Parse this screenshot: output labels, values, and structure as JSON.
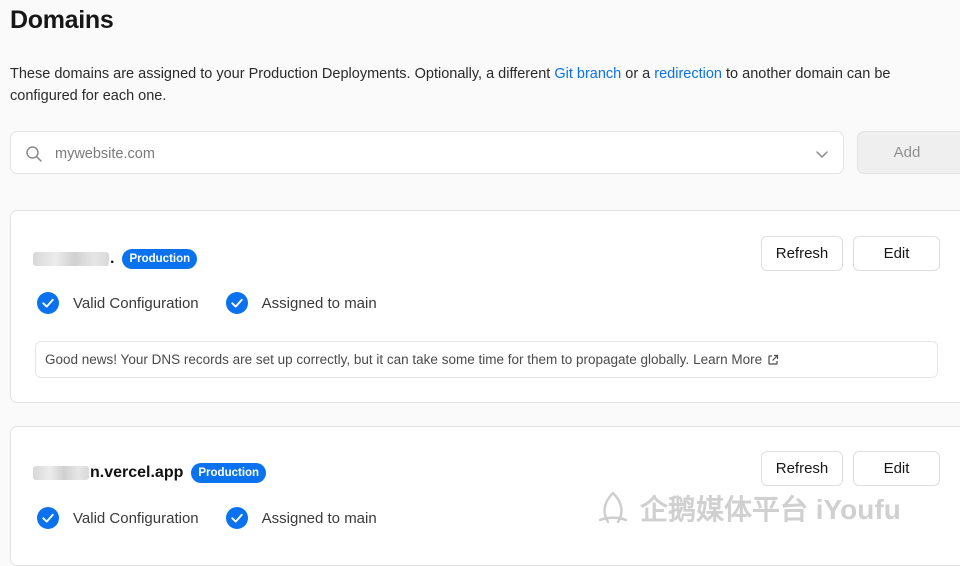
{
  "page": {
    "title": "Domains",
    "description": {
      "part1": "These domains are assigned to your Production Deployments. Optionally, a different ",
      "link1": "Git branch",
      "part2": " or a ",
      "link2": "redirection",
      "part3": " to another domain can be configured for each one."
    }
  },
  "search": {
    "placeholder": "mywebsite.com",
    "icon": "search-icon",
    "dropdown_icon": "chevron-down-icon",
    "add_label": "Add"
  },
  "domains": [
    {
      "suffix": ".",
      "badge": "Production",
      "refresh_label": "Refresh",
      "edit_label": "Edit",
      "status1": "Valid Configuration",
      "status2": "Assigned to main",
      "notice": "Good news! Your DNS records are set up correctly, but it can take some time for them to propagate globally.",
      "learn_more": "Learn More"
    },
    {
      "suffix": "n.vercel.app",
      "badge": "Production",
      "refresh_label": "Refresh",
      "edit_label": "Edit",
      "status1": "Valid Configuration",
      "status2": "Assigned to main"
    }
  ],
  "watermark": {
    "text": "企鹅媒体平台 iYoufu"
  },
  "colors": {
    "accent": "#0a72ef",
    "background": "#fafafa",
    "card": "#ffffff"
  }
}
